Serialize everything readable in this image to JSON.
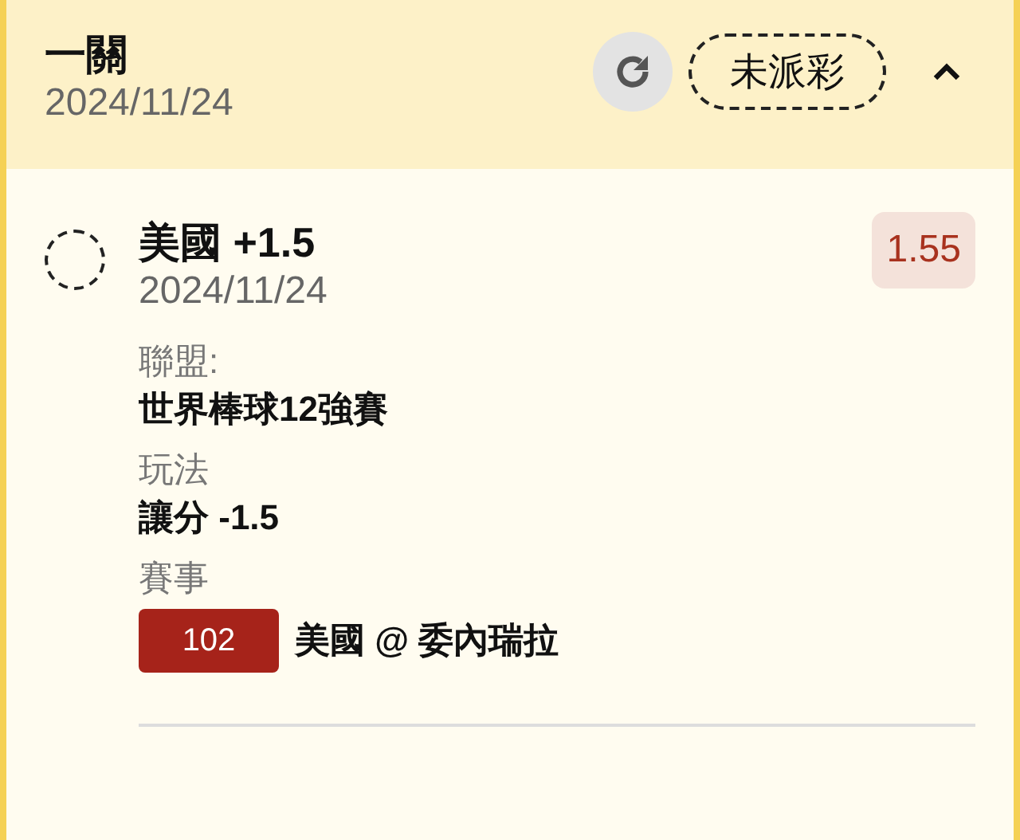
{
  "header": {
    "title": "一關",
    "date": "2024/11/24",
    "status": "未派彩",
    "expanded": true
  },
  "selection": {
    "selected": false,
    "title": "美國 +1.5",
    "date": "2024/11/24",
    "odds": "1.55",
    "details": [
      {
        "kind": "text",
        "label": "聯盟:",
        "value": "世界棒球12強賽"
      },
      {
        "kind": "text",
        "label": "玩法",
        "value": "讓分 -1.5"
      },
      {
        "kind": "event",
        "label": "賽事",
        "number": "102",
        "value": "美國 @ 委內瑞拉"
      }
    ]
  }
}
